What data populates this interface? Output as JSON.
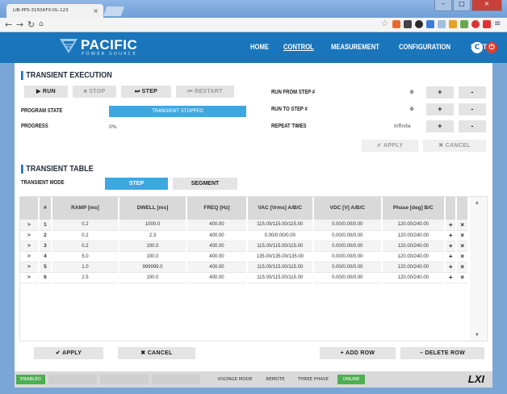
{
  "browser": {
    "tab_title": "LIB-PPS-3150AFX-DL-123",
    "address": "",
    "min_label": "–",
    "max_label": "□",
    "close_label": "×",
    "tab_close": "×"
  },
  "header": {
    "brand": "PACIFIC",
    "brand_sub": "POWER SOURCE",
    "nav": [
      "HOME",
      "CONTROL",
      "MEASUREMENT",
      "CONFIGURATION",
      "SYSTEM"
    ],
    "active_nav": "CONTROL",
    "accent": "#1b75bb"
  },
  "execution": {
    "title": "TRANSIENT EXECUTION",
    "run_label": "▶ RUN",
    "stop_label": "■ STOP",
    "step_label": "⏭ STEP",
    "restart_label": "⏮ RESTART",
    "program_state_label": "PROGRAM STATE",
    "program_state_value": "TRANSIENT STOPPED",
    "progress_label": "PROGRESS",
    "progress_value": "0%",
    "run_from_label": "RUN FROM STEP #",
    "run_from_value": "0",
    "run_to_label": "RUN TO STEP #",
    "run_to_value": "0",
    "repeat_label": "REPEAT TIMES",
    "repeat_value": "Infinite",
    "plus": "+",
    "minus": "-",
    "apply_label": "✔ APPLY",
    "cancel_label": "✖ CANCEL"
  },
  "table_section": {
    "title": "TRANSIENT TABLE",
    "mode_label": "TRANSIENT MODE",
    "mode_step": "STEP",
    "mode_segment": "SEGMENT",
    "active_mode": "STEP",
    "columns": [
      "#",
      "RAMP [ms]",
      "DWELL [ms]",
      "FREQ [Hz]",
      "VAC [Vrms] A/B/C",
      "VDC [V] A/B/C",
      "Phase [deg] B/C"
    ],
    "rows": [
      {
        "num": "1",
        "ramp": "0.2",
        "dwell": "1000.0",
        "freq": "400.00",
        "vac": "115.00/115.00/115.00",
        "vdc": "0.00/0.00/0.00",
        "phase": "120.00/240.00"
      },
      {
        "num": "2",
        "ramp": "0.2",
        "dwell": "2.3",
        "freq": "400.00",
        "vac": "0.00/0.00/0.00",
        "vdc": "0.00/0.00/0.00",
        "phase": "120.00/240.00"
      },
      {
        "num": "3",
        "ramp": "0.2",
        "dwell": "100.0",
        "freq": "400.00",
        "vac": "115.00/115.00/115.00",
        "vdc": "0.00/0.00/0.00",
        "phase": "120.00/240.00"
      },
      {
        "num": "4",
        "ramp": "5.0",
        "dwell": "100.0",
        "freq": "400.00",
        "vac": "135.00/135.00/135.00",
        "vdc": "0.00/0.00/0.00",
        "phase": "120.00/240.00"
      },
      {
        "num": "5",
        "ramp": "1.0",
        "dwell": "999999.0",
        "freq": "400.00",
        "vac": "115.00/115.00/115.00",
        "vdc": "0.00/0.00/0.00",
        "phase": "120.00/240.00"
      },
      {
        "num": "6",
        "ramp": "2.5",
        "dwell": "100.0",
        "freq": "400.00",
        "vac": "115.00/115.00/115.00",
        "vdc": "0.00/0.00/0.00",
        "phase": "120.00/240.00"
      }
    ],
    "row_arrow": ">",
    "add_symbol": "+",
    "del_symbol": "×",
    "apply_label": "✔ APPLY",
    "cancel_label": "✖ CANCEL",
    "add_row_label": "+ ADD ROW",
    "delete_row_label": "– DELETE ROW"
  },
  "footer": {
    "enabled": "ENABLED",
    "voltage_mode": "VOLTAGE MODE",
    "remote": "REMOTE",
    "three_phase": "THREE PHASE",
    "online": "ONLINE",
    "lxi": "LXI",
    "green": "#4caf50"
  }
}
